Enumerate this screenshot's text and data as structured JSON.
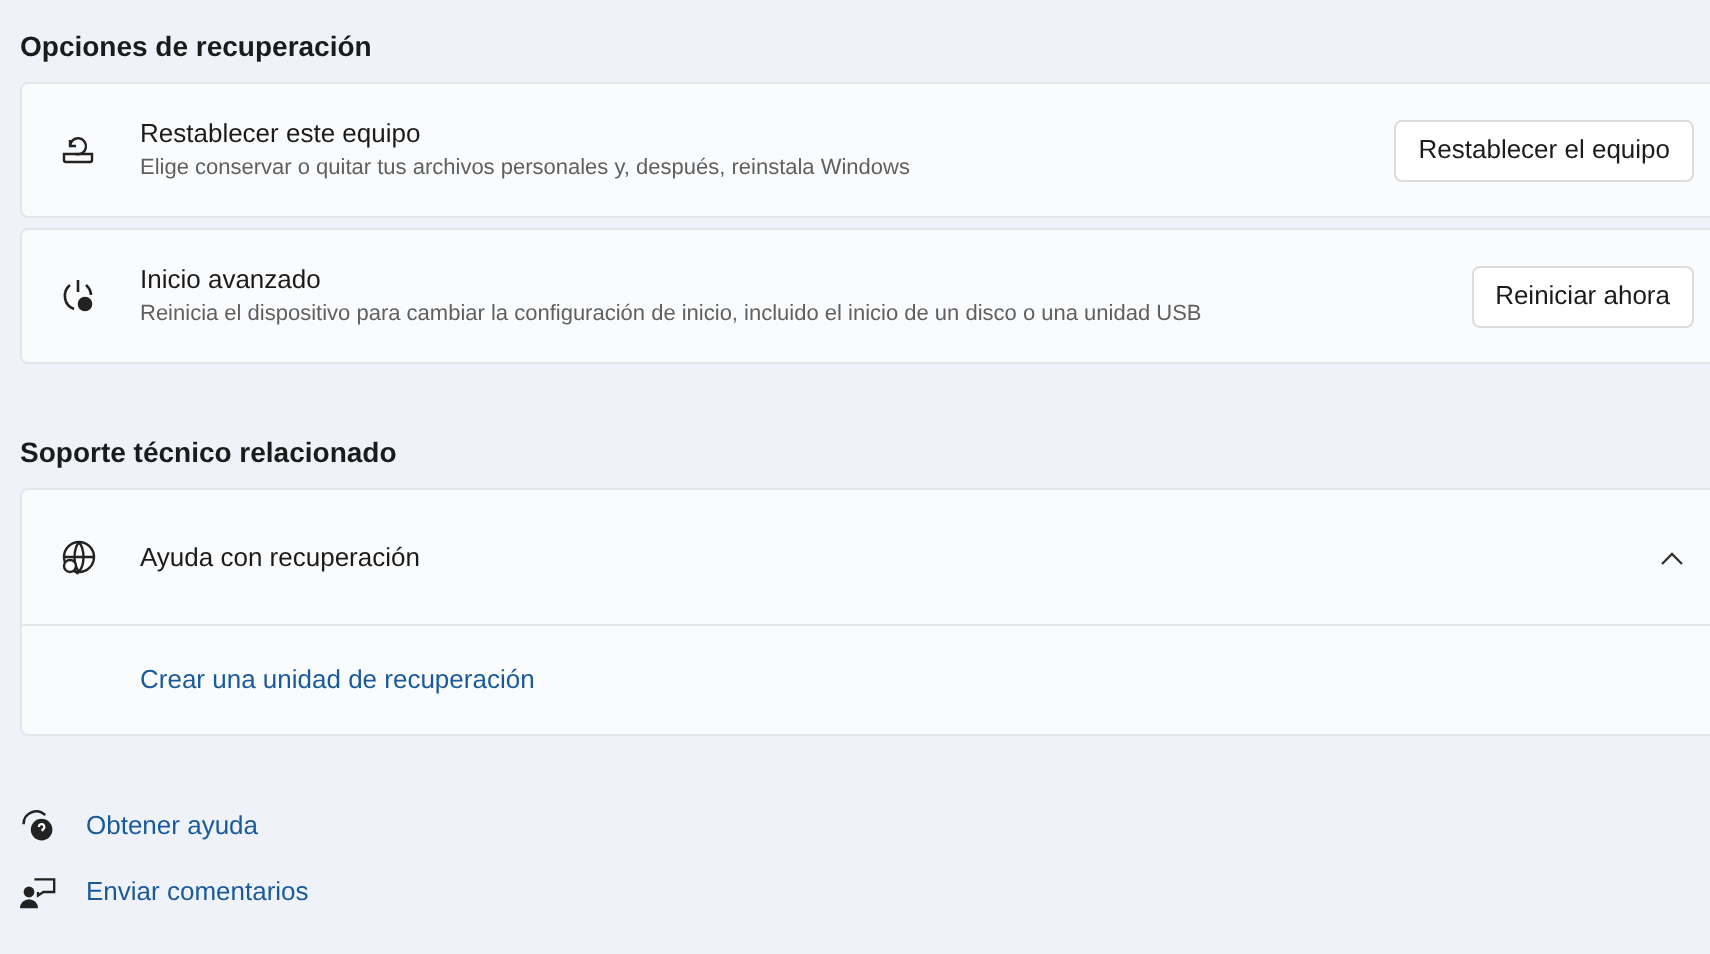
{
  "sections": [
    {
      "title": "Opciones de recuperación",
      "items": [
        {
          "kind": "action",
          "title": "Restablecer este equipo",
          "description": "Elige conservar o quitar tus archivos personales y, después, reinstala Windows",
          "button": "Restablecer el equipo"
        },
        {
          "kind": "action",
          "title": "Inicio avanzado",
          "description": "Reinicia el dispositivo para cambiar la configuración de inicio, incluido el inicio de un disco o una unidad USB",
          "button": "Reiniciar ahora"
        }
      ]
    },
    {
      "title": "Soporte técnico relacionado",
      "items": [
        {
          "kind": "expander",
          "title": "Ayuda con recuperación",
          "expanded": true,
          "links": [
            "Crear una unidad de recuperación"
          ]
        }
      ]
    }
  ],
  "footer_links": [
    {
      "label": "Obtener ayuda"
    },
    {
      "label": "Enviar comentarios"
    }
  ]
}
